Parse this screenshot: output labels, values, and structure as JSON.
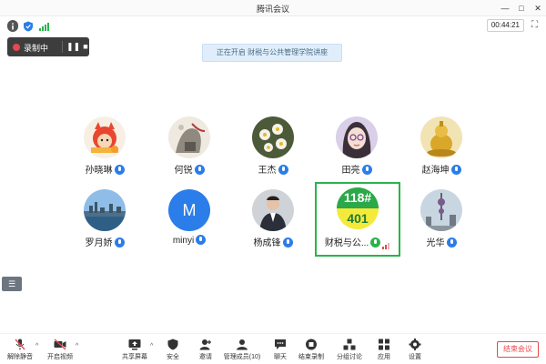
{
  "window": {
    "title": "腾讯会议",
    "minimize": "—",
    "maximize": "□",
    "close": "✕"
  },
  "info": {
    "timer": "00:44:21",
    "expand_icon": "fullscreen-icon"
  },
  "recording": {
    "label": "录制中"
  },
  "toast": {
    "text": "正在开启 财税与公共管理学院讲座"
  },
  "participants": [
    {
      "name": "孙晓琳"
    },
    {
      "name": "何锐"
    },
    {
      "name": "王杰"
    },
    {
      "name": "田亮"
    },
    {
      "name": "赵海坤"
    },
    {
      "name": "罗月娇"
    },
    {
      "name": "minyi",
      "initial": "M"
    },
    {
      "name": "杨成锋"
    },
    {
      "name": "财税与公...",
      "sticker_top": "118#",
      "sticker_bottom": "401",
      "speaking": true
    },
    {
      "name": "光华"
    }
  ],
  "toolbar": {
    "mute": "解除静音",
    "video": "开启视频",
    "share": "共享屏幕",
    "security": "安全",
    "invite": "邀请",
    "members": "管理成员(10)",
    "chat": "聊天",
    "record": "结束录制",
    "breakout": "分组讨论",
    "apps": "应用",
    "settings": "设置",
    "end": "结束会议"
  },
  "colors": {
    "accent": "#2b7de9",
    "danger": "#e5484d",
    "active_border": "#2ab34a"
  }
}
